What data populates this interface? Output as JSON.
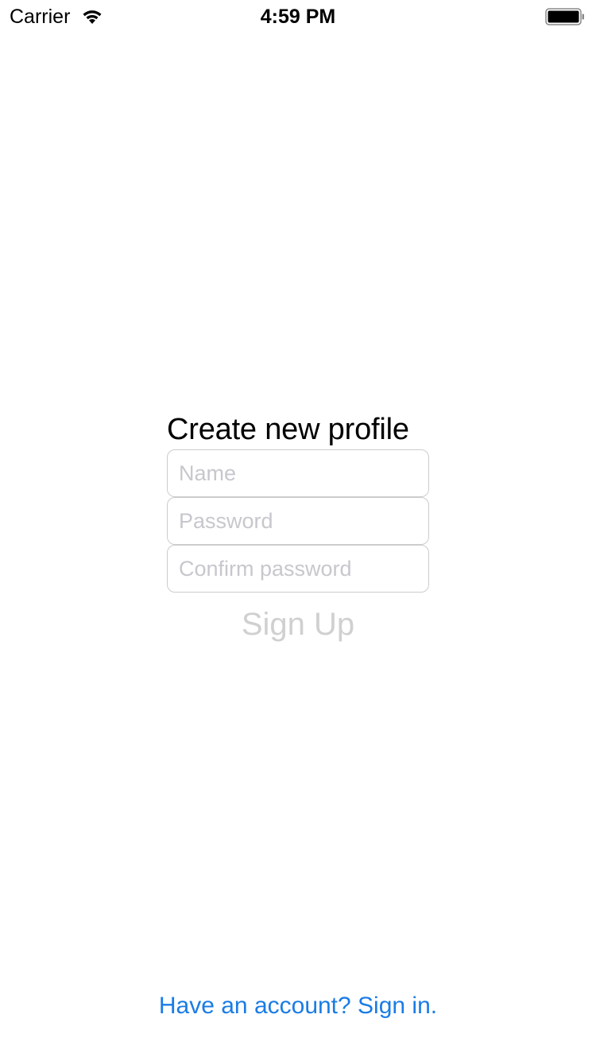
{
  "status_bar": {
    "carrier": "Carrier",
    "time": "4:59 PM",
    "wifi_icon": "wifi-icon",
    "battery_icon": "battery-icon"
  },
  "form": {
    "title": "Create new profile",
    "name_placeholder": "Name",
    "password_placeholder": "Password",
    "confirm_placeholder": "Confirm password",
    "signup_label": "Sign Up",
    "signup_color": "#d0d0d0"
  },
  "footer": {
    "signin_link": "Have an account? Sign in.",
    "link_color": "#1a7ce5"
  }
}
